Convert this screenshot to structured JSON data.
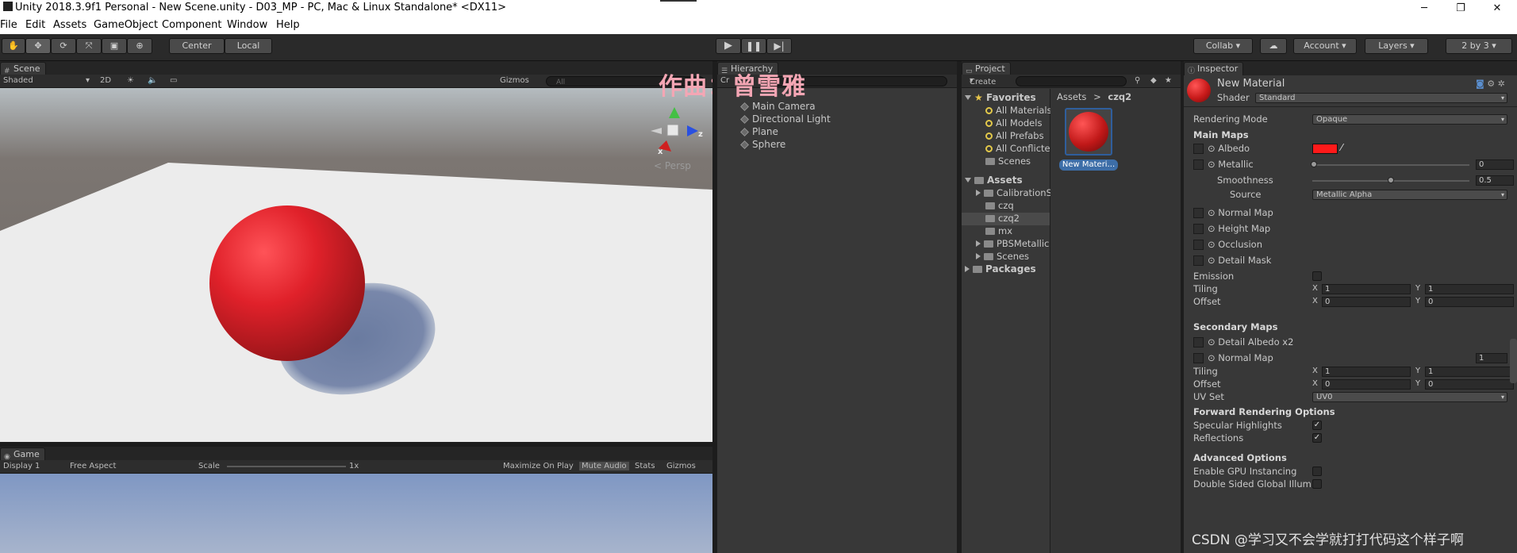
{
  "window": {
    "title": "Unity 2018.3.9f1 Personal - New Scene.unity - D03_MP - PC, Mac & Linux Standalone* <DX11>",
    "minimize": "─",
    "maximize": "❐",
    "close": "✕"
  },
  "menu": [
    "File",
    "Edit",
    "Assets",
    "GameObject",
    "Component",
    "Window",
    "Help"
  ],
  "toolbar": {
    "pivot": "Center",
    "space": "Local",
    "collab": "Collab",
    "account": "Account",
    "layers": "Layers",
    "layout": "2 by 3"
  },
  "scene": {
    "tab": "Scene",
    "shading": "Shaded",
    "mode_2d": "2D",
    "gizmos": "Gizmos",
    "search_placeholder": "All",
    "persp": "Persp",
    "gizmo_x": "x",
    "gizmo_z": "z"
  },
  "game": {
    "tab": "Game",
    "display": "Display 1",
    "aspect": "Free Aspect",
    "scale_label": "Scale",
    "scale_value": "1x",
    "maximize": "Maximize On Play",
    "mute": "Mute Audio",
    "stats": "Stats",
    "gizmos": "Gizmos"
  },
  "hierarchy": {
    "tab": "Hierarchy",
    "create": "Cr",
    "items": [
      "Main Camera",
      "Directional Light",
      "Plane",
      "Sphere"
    ]
  },
  "watermark_top": "作曲：曾雪雅",
  "project": {
    "tab": "Project",
    "create": "Create",
    "favorites_label": "Favorites",
    "favorites": [
      "All Materials",
      "All Models",
      "All Prefabs",
      "All Conflicte",
      "Scenes"
    ],
    "assets_label": "Assets",
    "assets": [
      "CalibrationS",
      "czq",
      "czq2",
      "mx",
      "PBSMetallic",
      "Scenes"
    ],
    "packages_label": "Packages",
    "breadcrumb_root": "Assets",
    "breadcrumb_sep": ">",
    "breadcrumb_current": "czq2",
    "asset_item": "New Materi..."
  },
  "inspector": {
    "tab": "Inspector",
    "name": "New Material",
    "shader_label": "Shader",
    "shader_value": "Standard",
    "rendering_mode_label": "Rendering Mode",
    "rendering_mode_value": "Opaque",
    "main_maps": "Main Maps",
    "albedo": "Albedo",
    "metallic": "Metallic",
    "metallic_value": "0",
    "smoothness": "Smoothness",
    "smoothness_value": "0.5",
    "source": "Source",
    "source_value": "Metallic Alpha",
    "normal_map": "Normal Map",
    "height_map": "Height Map",
    "occlusion": "Occlusion",
    "detail_mask": "Detail Mask",
    "emission": "Emission",
    "tiling": "Tiling",
    "offset": "Offset",
    "x": "X",
    "y": "Y",
    "one": "1",
    "zero": "0",
    "secondary_maps": "Secondary Maps",
    "detail_albedo": "Detail Albedo x2",
    "normal_map2": "Normal Map",
    "normal_map2_value": "1",
    "uv_set": "UV Set",
    "uv_set_value": "UV0",
    "forward": "Forward Rendering Options",
    "specular": "Specular Highlights",
    "reflections": "Reflections",
    "advanced": "Advanced Options",
    "gpu_instancing": "Enable GPU Instancing",
    "double_sided": "Double Sided Global Illum"
  },
  "watermark_bottom": "CSDN @学习又不会学就打打代码这个样子啊",
  "colors": {
    "albedo": "#ff1a1a",
    "sphere": "#d81e26"
  }
}
